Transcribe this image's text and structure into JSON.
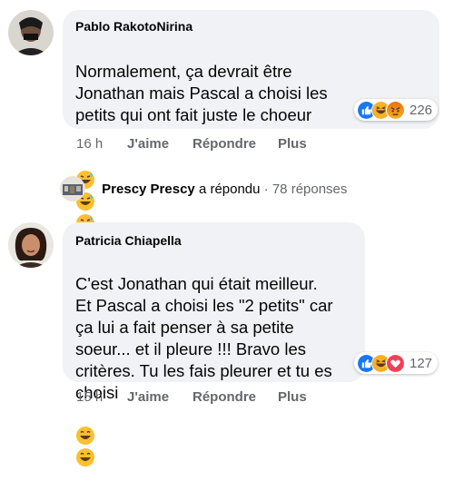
{
  "comments": [
    {
      "author": "Pablo RakotoNirina",
      "text": "Normalement, ça devrait être\nJonathan mais Pascal a choisi les\npetits qui ont fait juste le choeur",
      "trailing_emojis": [
        "grinning-sweat-emoji",
        "grinning-sweat-emoji",
        "grinning-sweat-emoji"
      ],
      "reactions": {
        "icons": [
          "like-reaction-icon",
          "haha-reaction-icon",
          "angry-reaction-icon"
        ],
        "count": "226"
      },
      "time": "16 h",
      "like_label": "J'aime",
      "reply_label": "Répondre",
      "more_label": "Plus"
    },
    {
      "author": "Patricia Chiapella",
      "text": "C'est Jonathan qui était meilleur.\nEt Pascal a choisi les \"2 petits\" car\nça lui a fait penser à sa petite\nsoeur... et il pleure !!! Bravo les\ncritères. Tu les fais pleurer et tu es\nchoisi",
      "trailing_emojis": [
        "grinning-emoji",
        "grinning-emoji"
      ],
      "reactions": {
        "icons": [
          "like-reaction-icon",
          "haha-reaction-icon",
          "love-reaction-icon"
        ],
        "count": "127"
      },
      "time": "15 h",
      "like_label": "J'aime",
      "reply_label": "Répondre",
      "more_label": "Plus"
    }
  ],
  "reply_summary": {
    "name": "Prescy Prescy",
    "action": "a répondu",
    "separator": "·",
    "count_label": "78 réponses"
  },
  "colors": {
    "bubble": "#f0f2f5",
    "secondary_text": "#65676b",
    "like_blue": "#1877f2",
    "haha_yellow": "#f7b125",
    "angry_orange": "#e9710f",
    "love_red": "#f33e58"
  }
}
